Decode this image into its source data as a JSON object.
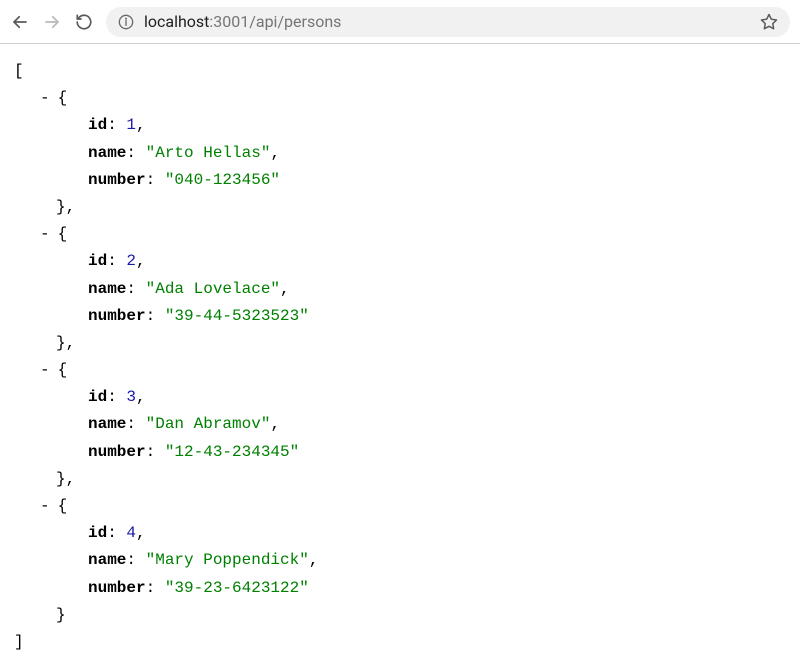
{
  "toolbar": {
    "url_host": "localhost",
    "url_rest": ":3001/api/persons"
  },
  "json": {
    "keys": {
      "id": "id",
      "name": "name",
      "number": "number"
    },
    "persons": [
      {
        "id": "1",
        "name": "\"Arto Hellas\"",
        "number": "\"040-123456\""
      },
      {
        "id": "2",
        "name": "\"Ada Lovelace\"",
        "number": "\"39-44-5323523\""
      },
      {
        "id": "3",
        "name": "\"Dan Abramov\"",
        "number": "\"12-43-234345\""
      },
      {
        "id": "4",
        "name": "\"Mary Poppendick\"",
        "number": "\"39-23-6423122\""
      }
    ]
  }
}
